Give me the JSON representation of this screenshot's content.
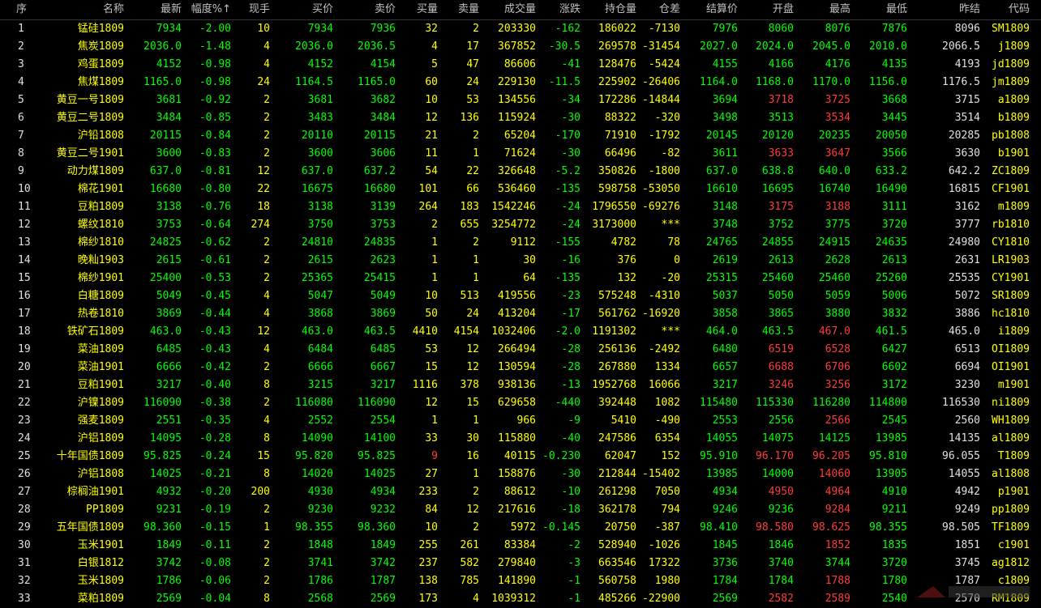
{
  "headers": [
    "序",
    "名称",
    "最新",
    "幅度%↑",
    "现手",
    "买价",
    "卖价",
    "买量",
    "卖量",
    "成交量",
    "涨跌",
    "持仓量",
    "仓差",
    "结算价",
    "开盘",
    "最高",
    "最低",
    "昨结",
    "代码"
  ],
  "colors": {
    "up": "#ff3b3b",
    "down": "#00ff00",
    "neutral": "#ffff00",
    "text": "#e0e0e0"
  },
  "rows": [
    {
      "idx": "1",
      "name": "锰硅1809",
      "last": "7934",
      "pct": "-2.00",
      "hand": "10",
      "bid": "7934",
      "ask": "7936",
      "bv": "32",
      "av": "2",
      "vol": "203330",
      "chg": "-162",
      "oi": "186022",
      "oid": "-7130",
      "settle": "7976",
      "open": "8060",
      "high": "8076",
      "low": "7876",
      "prev": "8096",
      "code": "SM1809",
      "bvc": "y",
      "ohc": "y"
    },
    {
      "idx": "2",
      "name": "焦炭1809",
      "last": "2036.0",
      "pct": "-1.48",
      "hand": "4",
      "bid": "2036.0",
      "ask": "2036.5",
      "bv": "4",
      "av": "17",
      "vol": "367852",
      "chg": "-30.5",
      "oi": "269578",
      "oid": "-31454",
      "settle": "2027.0",
      "open": "2024.0",
      "high": "2045.0",
      "low": "2010.0",
      "prev": "2066.5",
      "code": "j1809",
      "bvc": "y",
      "ohc": "g"
    },
    {
      "idx": "3",
      "name": "鸡蛋1809",
      "last": "4152",
      "pct": "-0.98",
      "hand": "4",
      "bid": "4152",
      "ask": "4154",
      "bv": "5",
      "av": "47",
      "vol": "86606",
      "chg": "-41",
      "oi": "128476",
      "oid": "-5424",
      "settle": "4155",
      "open": "4166",
      "high": "4176",
      "low": "4135",
      "prev": "4193",
      "code": "jd1809",
      "bvc": "y",
      "ohc": "g"
    },
    {
      "idx": "4",
      "name": "焦煤1809",
      "last": "1165.0",
      "pct": "-0.98",
      "hand": "24",
      "bid": "1164.5",
      "ask": "1165.0",
      "bv": "60",
      "av": "24",
      "vol": "229130",
      "chg": "-11.5",
      "oi": "225902",
      "oid": "-26406",
      "settle": "1164.0",
      "open": "1168.0",
      "high": "1170.0",
      "low": "1156.0",
      "prev": "1176.5",
      "code": "jm1809",
      "bvc": "y",
      "ohc": "g"
    },
    {
      "idx": "5",
      "name": "黄豆一号1809",
      "last": "3681",
      "pct": "-0.92",
      "hand": "2",
      "bid": "3681",
      "ask": "3682",
      "bv": "10",
      "av": "53",
      "vol": "134556",
      "chg": "-34",
      "oi": "172286",
      "oid": "-14844",
      "settle": "3694",
      "open": "3718",
      "high": "3725",
      "low": "3668",
      "prev": "3715",
      "code": "a1809",
      "bvc": "y",
      "ohc": "r"
    },
    {
      "idx": "6",
      "name": "黄豆二号1809",
      "last": "3484",
      "pct": "-0.85",
      "hand": "2",
      "bid": "3483",
      "ask": "3484",
      "bv": "12",
      "av": "136",
      "vol": "115924",
      "chg": "-30",
      "oi": "88322",
      "oid": "-320",
      "settle": "3498",
      "open": "3513",
      "high": "3534",
      "low": "3445",
      "prev": "3514",
      "code": "b1809",
      "bvc": "y",
      "ohc": "gr"
    },
    {
      "idx": "7",
      "name": "沪铅1808",
      "last": "20115",
      "pct": "-0.84",
      "hand": "2",
      "bid": "20110",
      "ask": "20115",
      "bv": "21",
      "av": "2",
      "vol": "65204",
      "chg": "-170",
      "oi": "71910",
      "oid": "-1792",
      "settle": "20145",
      "open": "20120",
      "high": "20235",
      "low": "20050",
      "prev": "20285",
      "code": "pb1808",
      "bvc": "y",
      "ohc": "g"
    },
    {
      "idx": "8",
      "name": "黄豆二号1901",
      "last": "3600",
      "pct": "-0.83",
      "hand": "2",
      "bid": "3600",
      "ask": "3606",
      "bv": "11",
      "av": "1",
      "vol": "71624",
      "chg": "-30",
      "oi": "66496",
      "oid": "-82",
      "settle": "3611",
      "open": "3633",
      "high": "3647",
      "low": "3566",
      "prev": "3630",
      "code": "b1901",
      "bvc": "y",
      "ohc": "r"
    },
    {
      "idx": "9",
      "name": "动力煤1809",
      "last": "637.0",
      "pct": "-0.81",
      "hand": "12",
      "bid": "637.0",
      "ask": "637.2",
      "bv": "54",
      "av": "22",
      "vol": "326648",
      "chg": "-5.2",
      "oi": "350826",
      "oid": "-1800",
      "settle": "637.0",
      "open": "638.8",
      "high": "640.0",
      "low": "633.2",
      "prev": "642.2",
      "code": "ZC1809",
      "bvc": "y",
      "ohc": "g"
    },
    {
      "idx": "10",
      "name": "棉花1901",
      "last": "16680",
      "pct": "-0.80",
      "hand": "22",
      "bid": "16675",
      "ask": "16680",
      "bv": "101",
      "av": "66",
      "vol": "536460",
      "chg": "-135",
      "oi": "598758",
      "oid": "-53050",
      "settle": "16610",
      "open": "16695",
      "high": "16740",
      "low": "16490",
      "prev": "16815",
      "code": "CF1901",
      "bvc": "y",
      "ohc": "g"
    },
    {
      "idx": "11",
      "name": "豆粕1809",
      "last": "3138",
      "pct": "-0.76",
      "hand": "18",
      "bid": "3138",
      "ask": "3139",
      "bv": "264",
      "av": "183",
      "vol": "1542246",
      "chg": "-24",
      "oi": "1796550",
      "oid": "-69276",
      "settle": "3148",
      "open": "3175",
      "high": "3188",
      "low": "3111",
      "prev": "3162",
      "code": "m1809",
      "bvc": "y",
      "ohc": "r"
    },
    {
      "idx": "12",
      "name": "螺纹1810",
      "last": "3753",
      "pct": "-0.64",
      "hand": "274",
      "bid": "3750",
      "ask": "3753",
      "bv": "2",
      "av": "655",
      "vol": "3254772",
      "chg": "-24",
      "oi": "3173000",
      "oid": "***",
      "settle": "3748",
      "open": "3752",
      "high": "3775",
      "low": "3720",
      "prev": "3777",
      "code": "rb1810",
      "bvc": "y",
      "ohc": "g"
    },
    {
      "idx": "13",
      "name": "棉纱1810",
      "last": "24825",
      "pct": "-0.62",
      "hand": "2",
      "bid": "24810",
      "ask": "24835",
      "bv": "1",
      "av": "2",
      "vol": "9112",
      "chg": "-155",
      "oi": "4782",
      "oid": "78",
      "settle": "24765",
      "open": "24855",
      "high": "24915",
      "low": "24635",
      "prev": "24980",
      "code": "CY1810",
      "bvc": "y",
      "ohc": "g"
    },
    {
      "idx": "14",
      "name": "晚籼1903",
      "last": "2615",
      "pct": "-0.61",
      "hand": "2",
      "bid": "2615",
      "ask": "2623",
      "bv": "1",
      "av": "1",
      "vol": "30",
      "chg": "-16",
      "oi": "376",
      "oid": "0",
      "settle": "2619",
      "open": "2613",
      "high": "2628",
      "low": "2613",
      "prev": "2631",
      "code": "LR1903",
      "bvc": "y",
      "ohc": "g"
    },
    {
      "idx": "15",
      "name": "棉纱1901",
      "last": "25400",
      "pct": "-0.53",
      "hand": "2",
      "bid": "25365",
      "ask": "25415",
      "bv": "1",
      "av": "1",
      "vol": "64",
      "chg": "-135",
      "oi": "132",
      "oid": "-20",
      "settle": "25315",
      "open": "25460",
      "high": "25460",
      "low": "25260",
      "prev": "25535",
      "code": "CY1901",
      "bvc": "y",
      "ohc": "g"
    },
    {
      "idx": "16",
      "name": "白糖1809",
      "last": "5049",
      "pct": "-0.45",
      "hand": "4",
      "bid": "5047",
      "ask": "5049",
      "bv": "10",
      "av": "513",
      "vol": "419556",
      "chg": "-23",
      "oi": "575248",
      "oid": "-4310",
      "settle": "5037",
      "open": "5050",
      "high": "5059",
      "low": "5006",
      "prev": "5072",
      "code": "SR1809",
      "bvc": "y",
      "ohc": "g"
    },
    {
      "idx": "17",
      "name": "热卷1810",
      "last": "3869",
      "pct": "-0.44",
      "hand": "4",
      "bid": "3868",
      "ask": "3869",
      "bv": "50",
      "av": "24",
      "vol": "413204",
      "chg": "-17",
      "oi": "561762",
      "oid": "-16920",
      "settle": "3858",
      "open": "3865",
      "high": "3880",
      "low": "3832",
      "prev": "3886",
      "code": "hc1810",
      "bvc": "y",
      "ohc": "g"
    },
    {
      "idx": "18",
      "name": "铁矿石1809",
      "last": "463.0",
      "pct": "-0.43",
      "hand": "12",
      "bid": "463.0",
      "ask": "463.5",
      "bv": "4410",
      "av": "4154",
      "vol": "1032406",
      "chg": "-2.0",
      "oi": "1191302",
      "oid": "***",
      "settle": "464.0",
      "open": "463.5",
      "high": "467.0",
      "low": "461.5",
      "prev": "465.0",
      "code": "i1809",
      "bvc": "y",
      "ohc": "gr"
    },
    {
      "idx": "19",
      "name": "菜油1809",
      "last": "6485",
      "pct": "-0.43",
      "hand": "4",
      "bid": "6484",
      "ask": "6485",
      "bv": "53",
      "av": "12",
      "vol": "266494",
      "chg": "-28",
      "oi": "256136",
      "oid": "-2492",
      "settle": "6480",
      "open": "6519",
      "high": "6528",
      "low": "6427",
      "prev": "6513",
      "code": "OI1809",
      "bvc": "y",
      "ohc": "r"
    },
    {
      "idx": "20",
      "name": "菜油1901",
      "last": "6666",
      "pct": "-0.42",
      "hand": "2",
      "bid": "6666",
      "ask": "6667",
      "bv": "15",
      "av": "12",
      "vol": "130594",
      "chg": "-28",
      "oi": "267880",
      "oid": "1334",
      "settle": "6657",
      "open": "6688",
      "high": "6706",
      "low": "6602",
      "prev": "6694",
      "code": "OI1901",
      "bvc": "y",
      "ohc": "r"
    },
    {
      "idx": "21",
      "name": "豆粕1901",
      "last": "3217",
      "pct": "-0.40",
      "hand": "8",
      "bid": "3215",
      "ask": "3217",
      "bv": "1116",
      "av": "378",
      "vol": "938136",
      "chg": "-13",
      "oi": "1952768",
      "oid": "16066",
      "settle": "3217",
      "open": "3246",
      "high": "3256",
      "low": "3172",
      "prev": "3230",
      "code": "m1901",
      "bvc": "y",
      "ohc": "r"
    },
    {
      "idx": "22",
      "name": "沪镍1809",
      "last": "116090",
      "pct": "-0.38",
      "hand": "2",
      "bid": "116080",
      "ask": "116090",
      "bv": "12",
      "av": "15",
      "vol": "629658",
      "chg": "-440",
      "oi": "392448",
      "oid": "1082",
      "settle": "115480",
      "open": "115330",
      "high": "116280",
      "low": "114800",
      "prev": "116530",
      "code": "ni1809",
      "bvc": "y",
      "ohc": "g"
    },
    {
      "idx": "23",
      "name": "强麦1809",
      "last": "2551",
      "pct": "-0.35",
      "hand": "4",
      "bid": "2552",
      "ask": "2554",
      "bv": "1",
      "av": "1",
      "vol": "966",
      "chg": "-9",
      "oi": "5410",
      "oid": "-490",
      "settle": "2553",
      "open": "2556",
      "high": "2566",
      "low": "2545",
      "prev": "2560",
      "code": "WH1809",
      "bvc": "y",
      "ohc": "gr"
    },
    {
      "idx": "24",
      "name": "沪铝1809",
      "last": "14095",
      "pct": "-0.28",
      "hand": "8",
      "bid": "14090",
      "ask": "14100",
      "bv": "33",
      "av": "30",
      "vol": "115880",
      "chg": "-40",
      "oi": "247586",
      "oid": "6354",
      "settle": "14055",
      "open": "14075",
      "high": "14125",
      "low": "13985",
      "prev": "14135",
      "code": "al1809",
      "bvc": "y",
      "ohc": "g"
    },
    {
      "idx": "25",
      "name": "十年国债1809",
      "last": "95.825",
      "pct": "-0.24",
      "hand": "15",
      "bid": "95.820",
      "ask": "95.825",
      "bv": "9",
      "av": "16",
      "vol": "40115",
      "chg": "-0.230",
      "oi": "62047",
      "oid": "152",
      "settle": "95.910",
      "open": "96.170",
      "high": "96.205",
      "low": "95.810",
      "prev": "96.055",
      "code": "T1809",
      "bvc": "r",
      "ohc": "r"
    },
    {
      "idx": "26",
      "name": "沪铝1808",
      "last": "14025",
      "pct": "-0.21",
      "hand": "8",
      "bid": "14020",
      "ask": "14025",
      "bv": "27",
      "av": "1",
      "vol": "158876",
      "chg": "-30",
      "oi": "212844",
      "oid": "-15402",
      "settle": "13985",
      "open": "14000",
      "high": "14060",
      "low": "13905",
      "prev": "14055",
      "code": "al1808",
      "bvc": "y",
      "ohc": "gr"
    },
    {
      "idx": "27",
      "name": "棕榈油1901",
      "last": "4932",
      "pct": "-0.20",
      "hand": "200",
      "bid": "4930",
      "ask": "4934",
      "bv": "233",
      "av": "2",
      "vol": "88612",
      "chg": "-10",
      "oi": "261298",
      "oid": "7050",
      "settle": "4934",
      "open": "4950",
      "high": "4964",
      "low": "4910",
      "prev": "4942",
      "code": "p1901",
      "bvc": "y",
      "ohc": "r"
    },
    {
      "idx": "28",
      "name": "PP1809",
      "last": "9231",
      "pct": "-0.19",
      "hand": "2",
      "bid": "9230",
      "ask": "9232",
      "bv": "84",
      "av": "12",
      "vol": "217616",
      "chg": "-18",
      "oi": "362178",
      "oid": "794",
      "settle": "9246",
      "open": "9236",
      "high": "9284",
      "low": "9211",
      "prev": "9249",
      "code": "pp1809",
      "bvc": "y",
      "ohc": "gr"
    },
    {
      "idx": "29",
      "name": "五年国债1809",
      "last": "98.360",
      "pct": "-0.15",
      "hand": "1",
      "bid": "98.355",
      "ask": "98.360",
      "bv": "10",
      "av": "2",
      "vol": "5972",
      "chg": "-0.145",
      "oi": "20750",
      "oid": "-387",
      "settle": "98.410",
      "open": "98.580",
      "high": "98.625",
      "low": "98.355",
      "prev": "98.505",
      "code": "TF1809",
      "bvc": "y",
      "ohc": "r"
    },
    {
      "idx": "30",
      "name": "玉米1901",
      "last": "1849",
      "pct": "-0.11",
      "hand": "2",
      "bid": "1848",
      "ask": "1849",
      "bv": "255",
      "av": "261",
      "vol": "83384",
      "chg": "-2",
      "oi": "528940",
      "oid": "-1026",
      "settle": "1845",
      "open": "1846",
      "high": "1852",
      "low": "1835",
      "prev": "1851",
      "code": "c1901",
      "bvc": "y",
      "ohc": "gr"
    },
    {
      "idx": "31",
      "name": "白银1812",
      "last": "3742",
      "pct": "-0.08",
      "hand": "2",
      "bid": "3741",
      "ask": "3742",
      "bv": "237",
      "av": "582",
      "vol": "279840",
      "chg": "-3",
      "oi": "663546",
      "oid": "17322",
      "settle": "3736",
      "open": "3740",
      "high": "3744",
      "low": "3720",
      "prev": "3745",
      "code": "ag1812",
      "bvc": "y",
      "ohc": "g"
    },
    {
      "idx": "32",
      "name": "玉米1809",
      "last": "1786",
      "pct": "-0.06",
      "hand": "2",
      "bid": "1786",
      "ask": "1787",
      "bv": "138",
      "av": "785",
      "vol": "141890",
      "chg": "-1",
      "oi": "560758",
      "oid": "1980",
      "settle": "1784",
      "open": "1784",
      "high": "1788",
      "low": "1780",
      "prev": "1787",
      "code": "c1809",
      "bvc": "y",
      "ohc": "gr"
    },
    {
      "idx": "33",
      "name": "菜粕1809",
      "last": "2569",
      "pct": "-0.04",
      "hand": "8",
      "bid": "2568",
      "ask": "2569",
      "bv": "173",
      "av": "4",
      "vol": "1039312",
      "chg": "-1",
      "oi": "485266",
      "oid": "-22900",
      "settle": "2569",
      "open": "2582",
      "high": "2589",
      "low": "2540",
      "prev": "2570",
      "code": "RM1809",
      "bvc": "y",
      "ohc": "r"
    }
  ]
}
